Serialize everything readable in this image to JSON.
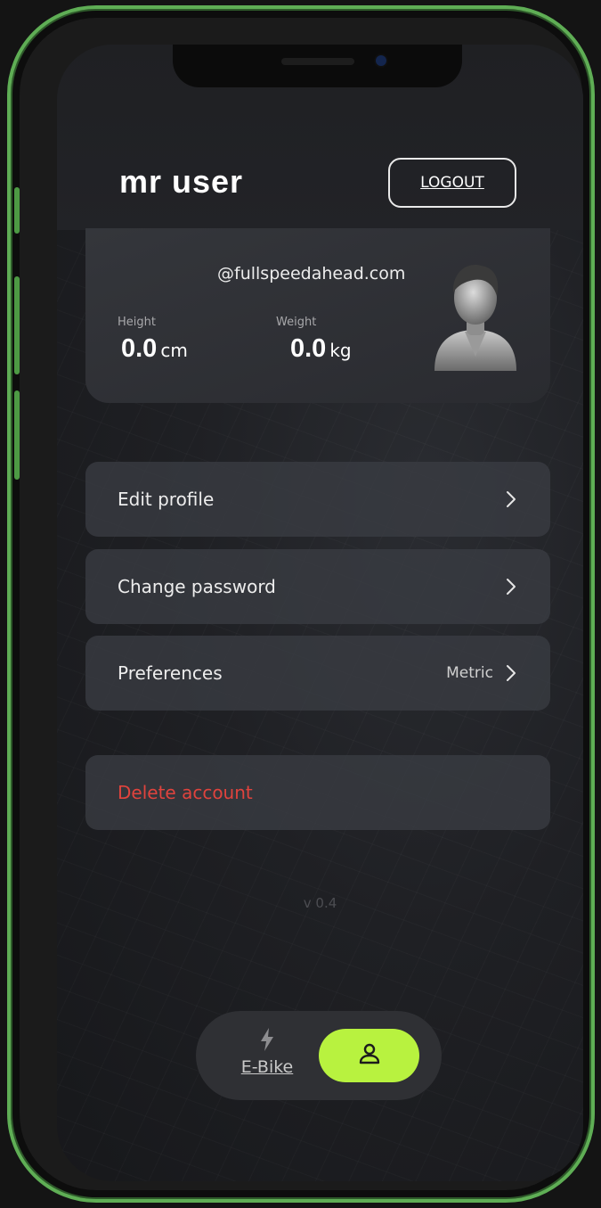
{
  "header": {
    "user_name": "mr user",
    "logout_label": "LOGOUT"
  },
  "profile": {
    "email": "@fullspeedahead.com",
    "height_label": "Height",
    "height_value": "0.0",
    "height_unit": "cm",
    "weight_label": "Weight",
    "weight_value": "0.0",
    "weight_unit": "kg",
    "avatar_icon": "user-avatar-icon"
  },
  "menu": {
    "items": [
      {
        "label": "Edit profile",
        "icon": "chevron-right-icon"
      },
      {
        "label": "Change password",
        "icon": "chevron-right-icon"
      },
      {
        "label": "Preferences",
        "value": "Metric",
        "icon": "chevron-right-icon"
      }
    ],
    "delete_label": "Delete account"
  },
  "version": "v 0.4",
  "tabbar": {
    "ebike_label": "E-Bike",
    "ebike_icon": "lightning-icon",
    "profile_icon": "person-icon"
  },
  "colors": {
    "accent": "#b8f23f",
    "danger": "#e0433d",
    "frame": "#5fae55"
  }
}
